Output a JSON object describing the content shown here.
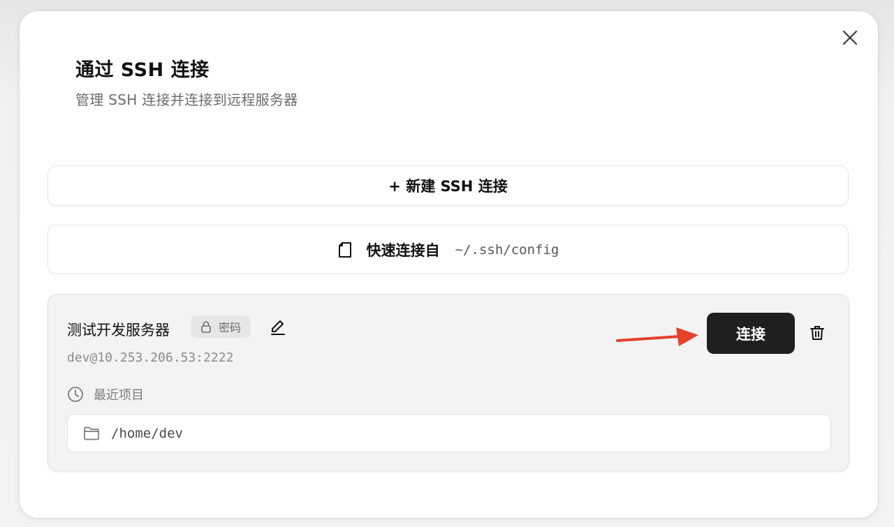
{
  "dialog": {
    "title": "通过 SSH 连接",
    "subtitle": "管理 SSH 连接并连接到远程服务器",
    "close_icon": "close-icon"
  },
  "actions": {
    "new_connection_label": "+ 新建 SSH 连接",
    "quick_connect_label": "快速连接自",
    "quick_connect_path": "~/.ssh/config",
    "quick_connect_icon": "file-icon"
  },
  "server": {
    "name": "测试开发服务器",
    "auth_badge": "密码",
    "auth_icon": "lock-icon",
    "address": "dev@10.253.206.53:2222",
    "connect_label": "连接",
    "edit_icon": "pencil-icon",
    "delete_icon": "trash-icon",
    "recent_label": "最近项目",
    "recent_icon": "clock-icon",
    "recent_projects": [
      {
        "path": "/home/dev",
        "icon": "folder-icon"
      }
    ]
  },
  "colors": {
    "connect_button_bg": "#1f1f1f",
    "annotation_arrow": "#e5412b",
    "card_bg": "#f3f3f3"
  }
}
